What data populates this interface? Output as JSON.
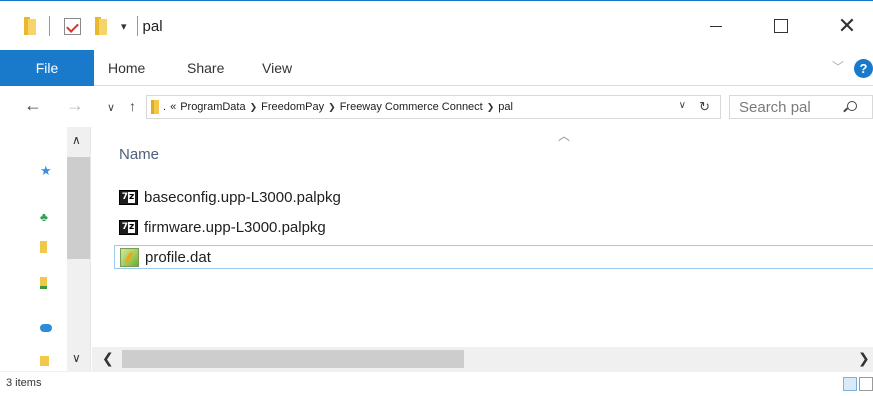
{
  "window": {
    "title": "pal",
    "qat_dropdown": "▾"
  },
  "ribbon": {
    "tabs": [
      "File",
      "Home",
      "Share",
      "View"
    ],
    "help": "?"
  },
  "address_bar": {
    "overflow": "«",
    "path": [
      "ProgramData",
      "FreedomPay",
      "Freeway Commerce Connect",
      "pal"
    ],
    "dot": "."
  },
  "search": {
    "placeholder": "Search pal"
  },
  "file_list": {
    "column_header": "Name",
    "files": [
      {
        "name": "baseconfig.upp-L3000.palpkg",
        "icon": "7z-archive-icon"
      },
      {
        "name": "firmware.upp-L3000.palpkg",
        "icon": "7z-archive-icon"
      },
      {
        "name": "profile.dat",
        "icon": "dat-file-icon"
      }
    ]
  },
  "status_bar": {
    "item_count": "3 items"
  }
}
